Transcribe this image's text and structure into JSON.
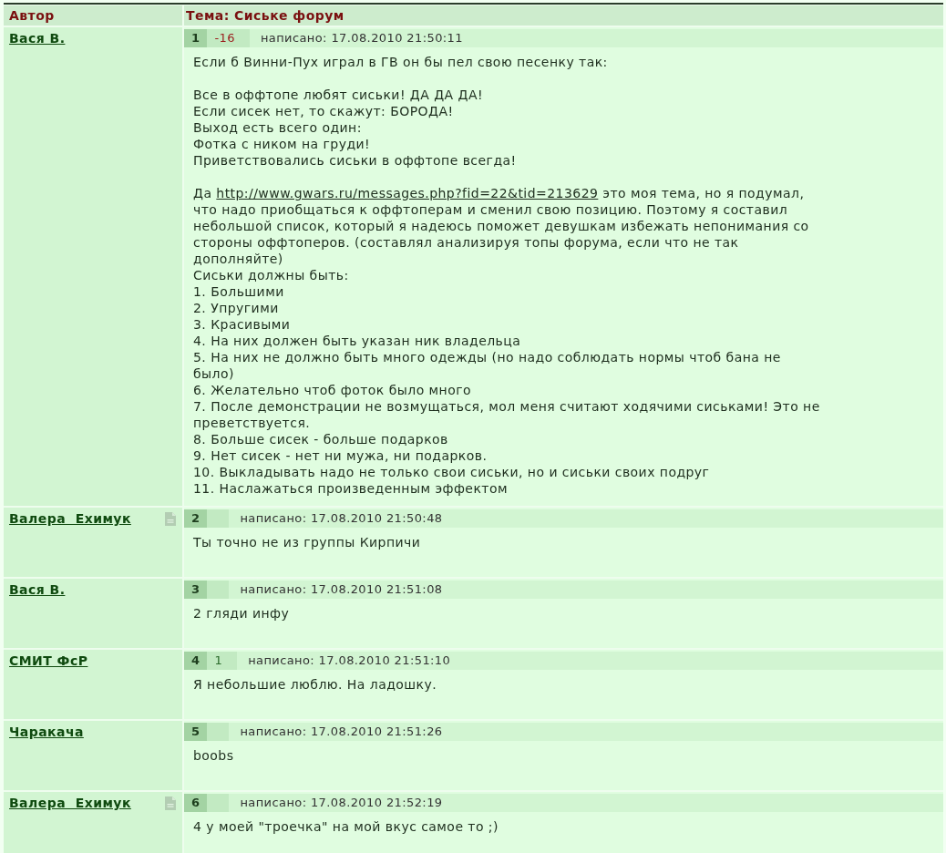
{
  "table": {
    "columns": [
      "Автор",
      "Тема: Сиське форум"
    ]
  },
  "posts": [
    {
      "author": "Вася В.",
      "doc_icon": false,
      "number": "1",
      "rating": {
        "text": "-16",
        "color": "#9b1b1b"
      },
      "timestamp": "написано: 17.08.2010 21:50:11",
      "paragraphs": [
        [
          {
            "kind": "text",
            "text": "Если б Винни-Пух играл в ГВ он бы пел свою песенку так:"
          }
        ],
        [
          {
            "kind": "text",
            "text": "Все в оффтопе любят сиськи! ДА ДА ДА!"
          },
          {
            "kind": "text",
            "text": "Если сисек нет, то скажут: БОРОДА!"
          },
          {
            "kind": "text",
            "text": "Выход есть всего один:"
          },
          {
            "kind": "text",
            "text": "Фотка с ником на груди!"
          },
          {
            "kind": "text",
            "text": "Приветствовались сиськи в оффтопе всегда!"
          }
        ],
        [
          {
            "kind": "link",
            "before": "Да ",
            "link": "http://www.gwars.ru/messages.php?fid=22&tid=213629",
            "after": " это моя тема, но я подумал, что надо приобщаться к оффтоперам и сменил свою позицию. Поэтому я составил небольшой список, который я надеюсь поможет девушкам избежать непонимания со стороны оффтоперов. (составлял анализируя топы форума, если что не так дополняйте)"
          },
          {
            "kind": "text",
            "text": "Сиськи должны быть:"
          },
          {
            "kind": "text",
            "text": "1. Большими"
          },
          {
            "kind": "text",
            "text": "2. Упругими"
          },
          {
            "kind": "text",
            "text": "3. Красивыми"
          },
          {
            "kind": "text",
            "text": "4. На них должен быть указан ник владельца"
          },
          {
            "kind": "text",
            "text": "5. На них не должно быть много одежды (но надо соблюдать нормы чтоб бана не было)"
          },
          {
            "kind": "text",
            "text": "6. Желательно чтоб фоток было много"
          },
          {
            "kind": "text",
            "text": "7. После демонстрации не возмущаться, мол меня считают ходячими сиськами! Это не преветствуется."
          },
          {
            "kind": "text",
            "text": "8. Больше сисек - больше подарков"
          },
          {
            "kind": "text",
            "text": "9. Нет сисек - нет ни мужа, ни подарков."
          },
          {
            "kind": "text",
            "text": "10. Выкладывать надо не только свои сиськи, но и сиськи своих подруг"
          },
          {
            "kind": "text",
            "text": "11. Наслажаться произведенным эффектом"
          }
        ]
      ]
    },
    {
      "author": "Валера  Ехимук",
      "doc_icon": true,
      "number": "2",
      "timestamp": "написано: 17.08.2010 21:50:48",
      "paragraphs": [
        [
          {
            "kind": "text",
            "text": "Ты точно не из группы Кирпичи"
          }
        ]
      ]
    },
    {
      "author": "Вася В.",
      "doc_icon": false,
      "number": "3",
      "timestamp": "написано: 17.08.2010 21:51:08",
      "paragraphs": [
        [
          {
            "kind": "text",
            "text": "2 гляди инфу"
          }
        ]
      ]
    },
    {
      "author": "СМИТ ФсР",
      "doc_icon": false,
      "number": "4",
      "rating": {
        "text": "1",
        "color": "#2a6a2a"
      },
      "timestamp": "написано: 17.08.2010 21:51:10",
      "paragraphs": [
        [
          {
            "kind": "text",
            "text": "Я небольшие люблю. На ладошку."
          }
        ]
      ]
    },
    {
      "author": "Чаракача",
      "doc_icon": false,
      "number": "5",
      "timestamp": "написано: 17.08.2010 21:51:26",
      "paragraphs": [
        [
          {
            "kind": "text",
            "text": "boobs"
          }
        ]
      ]
    },
    {
      "author": "Валера  Ехимук",
      "doc_icon": true,
      "number": "6",
      "timestamp": "написано: 17.08.2010 21:52:19",
      "paragraphs": [
        [
          {
            "kind": "text",
            "text": "4 у моей \"троечка\" на мой вкус самое то ;)"
          }
        ]
      ]
    }
  ]
}
